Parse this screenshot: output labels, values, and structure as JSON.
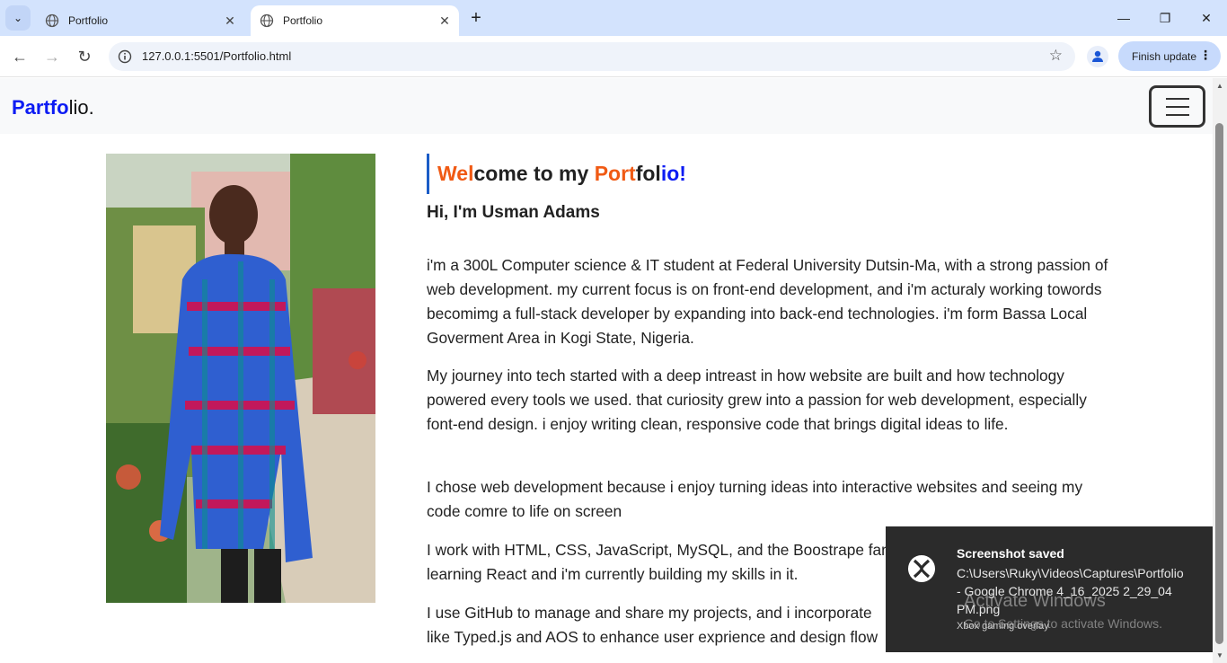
{
  "browser": {
    "tabs": [
      {
        "title": "Portfolio",
        "active": false
      },
      {
        "title": "Portfolio",
        "active": true
      }
    ],
    "url": "127.0.0.1:5501/Portfolio.html",
    "update_button": "Finish update"
  },
  "navbar": {
    "brand_bold": "Partfo",
    "brand_rest": "lio."
  },
  "hero": {
    "welcome_1": "Wel",
    "welcome_2": "come to my ",
    "welcome_3": "Port",
    "welcome_4": "fol",
    "welcome_5": "io!",
    "greeting": "Hi, I'm Usman Adams",
    "paragraphs": [
      "i'm a 300L Computer science & IT student at Federal University Dutsin-Ma, with a strong passion of web development. my current focus is on front-end development, and i'm acturaly working towords becomimg a full-stack developer by expanding into back-end technologies. i'm form Bassa Local Goverment Area in Kogi State, Nigeria.",
      "My journey into tech started with a deep intreast in how website are built and how technology powered every tools we used. that curiosity grew into a passion for web development, especially font-end design. i enjoy writing clean, responsive code that brings digital ideas to life.",
      "I chose web development because i enjoy turning ideas into interactive websites and seeing my code comre to life on screen",
      "I work with HTML, CSS, JavaScript, MySQL, and the Boostrape fan",
      "learning React and i'm currently building my skills in it.",
      "I use GitHub to manage and share my projects, and i incorporate",
      "like Typed.js and AOS to enhance user exprience and design flow"
    ]
  },
  "toast": {
    "title": "Screenshot saved",
    "path": "C:\\Users\\Ruky\\Videos\\Captures\\Portfolio - Google Chrome 4_16_2025 2_29_04 PM.png",
    "source": "Xbox gaming overlay"
  },
  "watermark": {
    "line1": "Activate Windows",
    "line2": "Go to Settings to activate Windows."
  },
  "colors": {
    "accent_orange": "#f05a14",
    "accent_blue": "#0d1cf3",
    "chrome_tabstrip": "#d3e3fd"
  }
}
